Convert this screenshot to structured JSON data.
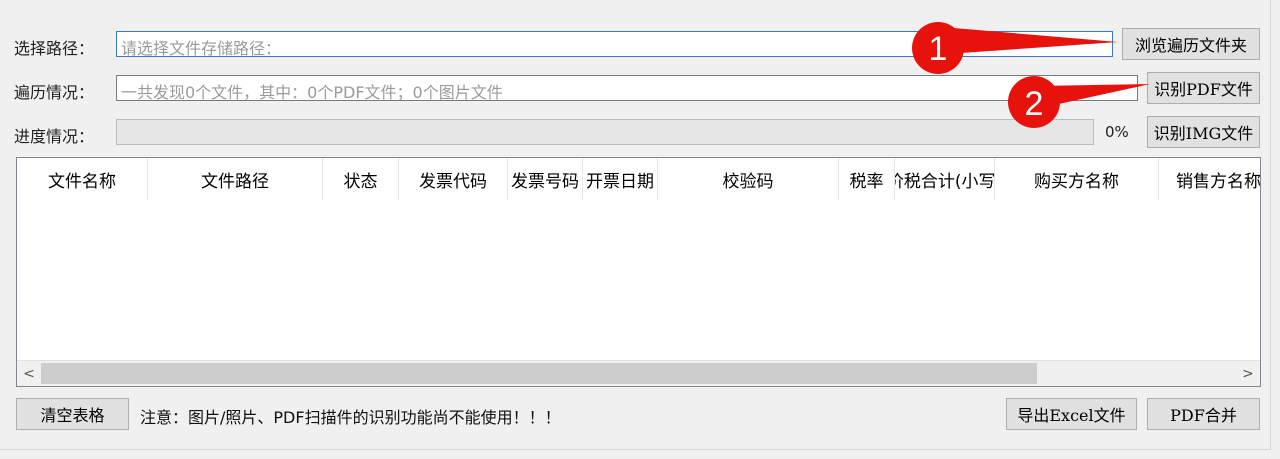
{
  "form": {
    "path_label": "选择路径：",
    "path_placeholder": "请选择文件存储路径：",
    "browse_button": "浏览遍历文件夹",
    "scan_label": "遍历情况：",
    "scan_value": "一共发现0个文件，其中：0个PDF文件；0个图片文件",
    "recognize_pdf_button": "识别PDF文件",
    "progress_label": "进度情况：",
    "progress_value": 0,
    "progress_text": "0%",
    "recognize_img_button": "识别IMG文件"
  },
  "table": {
    "columns": [
      "文件名称",
      "文件路径",
      "状态",
      "发票代码",
      "发票号码",
      "开票日期",
      "校验码",
      "税率",
      "价税合计(小写)",
      "购买方名称",
      "销售方名称"
    ],
    "rows": []
  },
  "scrollbar": {
    "left_arrow": "<",
    "right_arrow": ">"
  },
  "footer": {
    "clear_button": "清空表格",
    "notice": "注意：图片/照片、PDF扫描件的识别功能尚不能使用！！！",
    "export_button": "导出Excel文件",
    "merge_button": "PDF合并"
  },
  "annotations": {
    "badge1": "1",
    "badge2": "2",
    "color": "#e8120c"
  }
}
